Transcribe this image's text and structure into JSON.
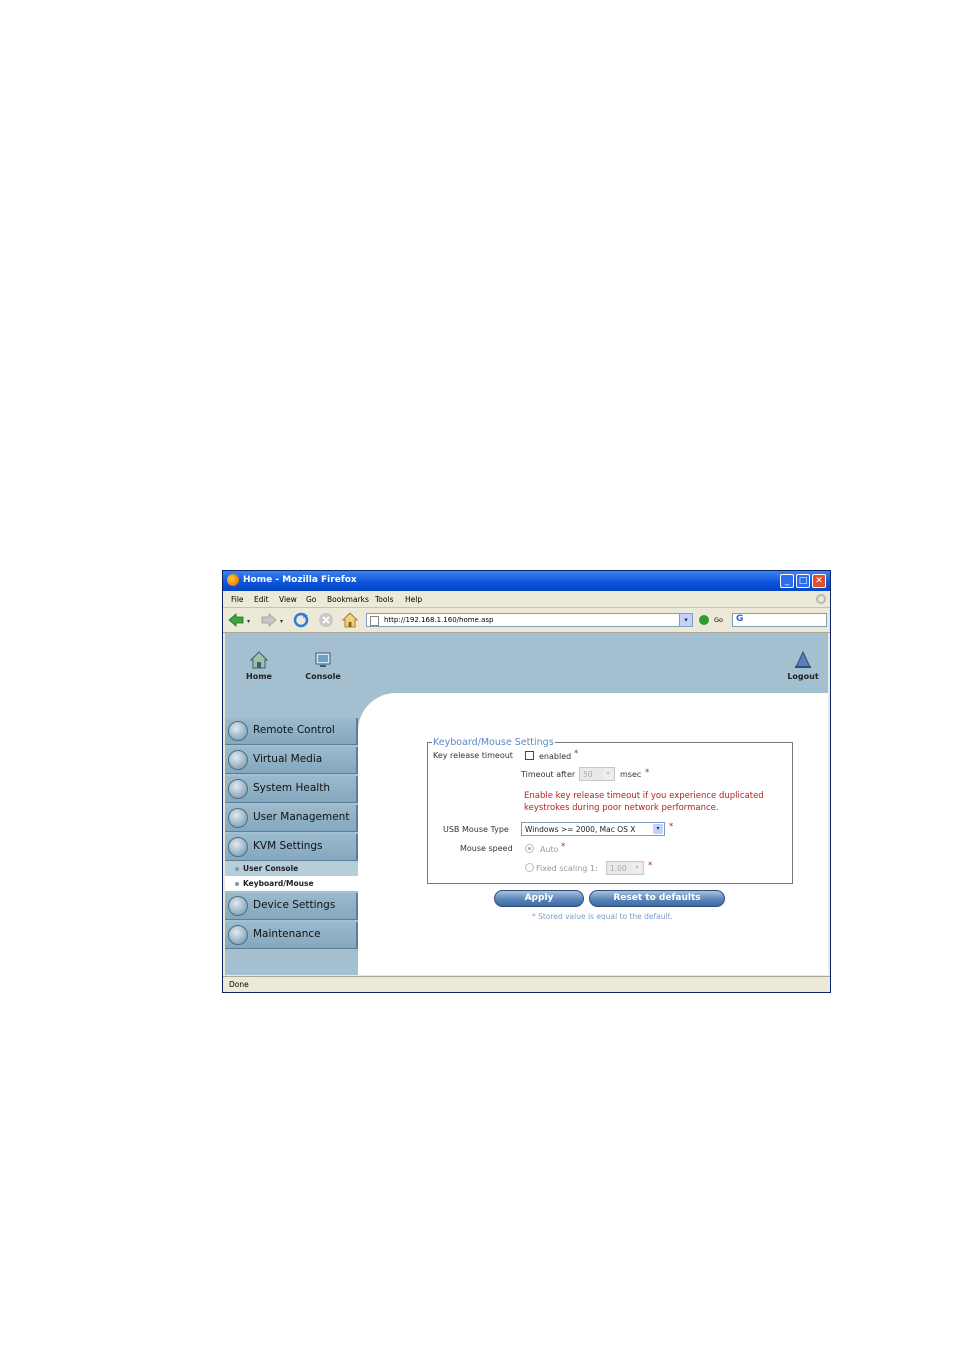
{
  "window": {
    "title": "Home - Mozilla Firefox"
  },
  "menu": [
    "File",
    "Edit",
    "View",
    "Go",
    "Bookmarks",
    "Tools",
    "Help"
  ],
  "nav": {
    "url": "http://192.168.1.160/home.asp",
    "go_label": "Go",
    "search_value": "G"
  },
  "toplinks": {
    "home": "Home",
    "console": "Console",
    "logout": "Logout"
  },
  "sidebar": {
    "items": [
      {
        "label": "Remote Control"
      },
      {
        "label": "Virtual Media"
      },
      {
        "label": "System Health"
      },
      {
        "label": "User Management"
      },
      {
        "label": "KVM Settings"
      }
    ],
    "subitems": [
      {
        "label": "User Console"
      },
      {
        "label": "Keyboard/Mouse"
      }
    ],
    "items_after": [
      {
        "label": "Device Settings"
      },
      {
        "label": "Maintenance"
      }
    ]
  },
  "form": {
    "legend": "Keyboard/Mouse Settings",
    "key_release_label": "Key release timeout",
    "enabled_label": "enabled",
    "timeout_after_label": "Timeout after",
    "timeout_value": "50",
    "msec_label": "msec",
    "warning_line1": "Enable key release timeout if you experience duplicated",
    "warning_line2": "keystrokes during poor network performance.",
    "usb_mouse_label": "USB Mouse Type",
    "usb_mouse_value": "Windows >= 2000, Mac OS X",
    "mouse_speed_label": "Mouse speed",
    "auto_label": "Auto",
    "fixed_label": "Fixed scaling 1:",
    "fixed_value": "1.00",
    "asterisk": "*",
    "apply_label": "Apply",
    "reset_label": "Reset to defaults",
    "footnote": "* Stored value is equal to the default."
  },
  "status": {
    "text": "Done"
  }
}
